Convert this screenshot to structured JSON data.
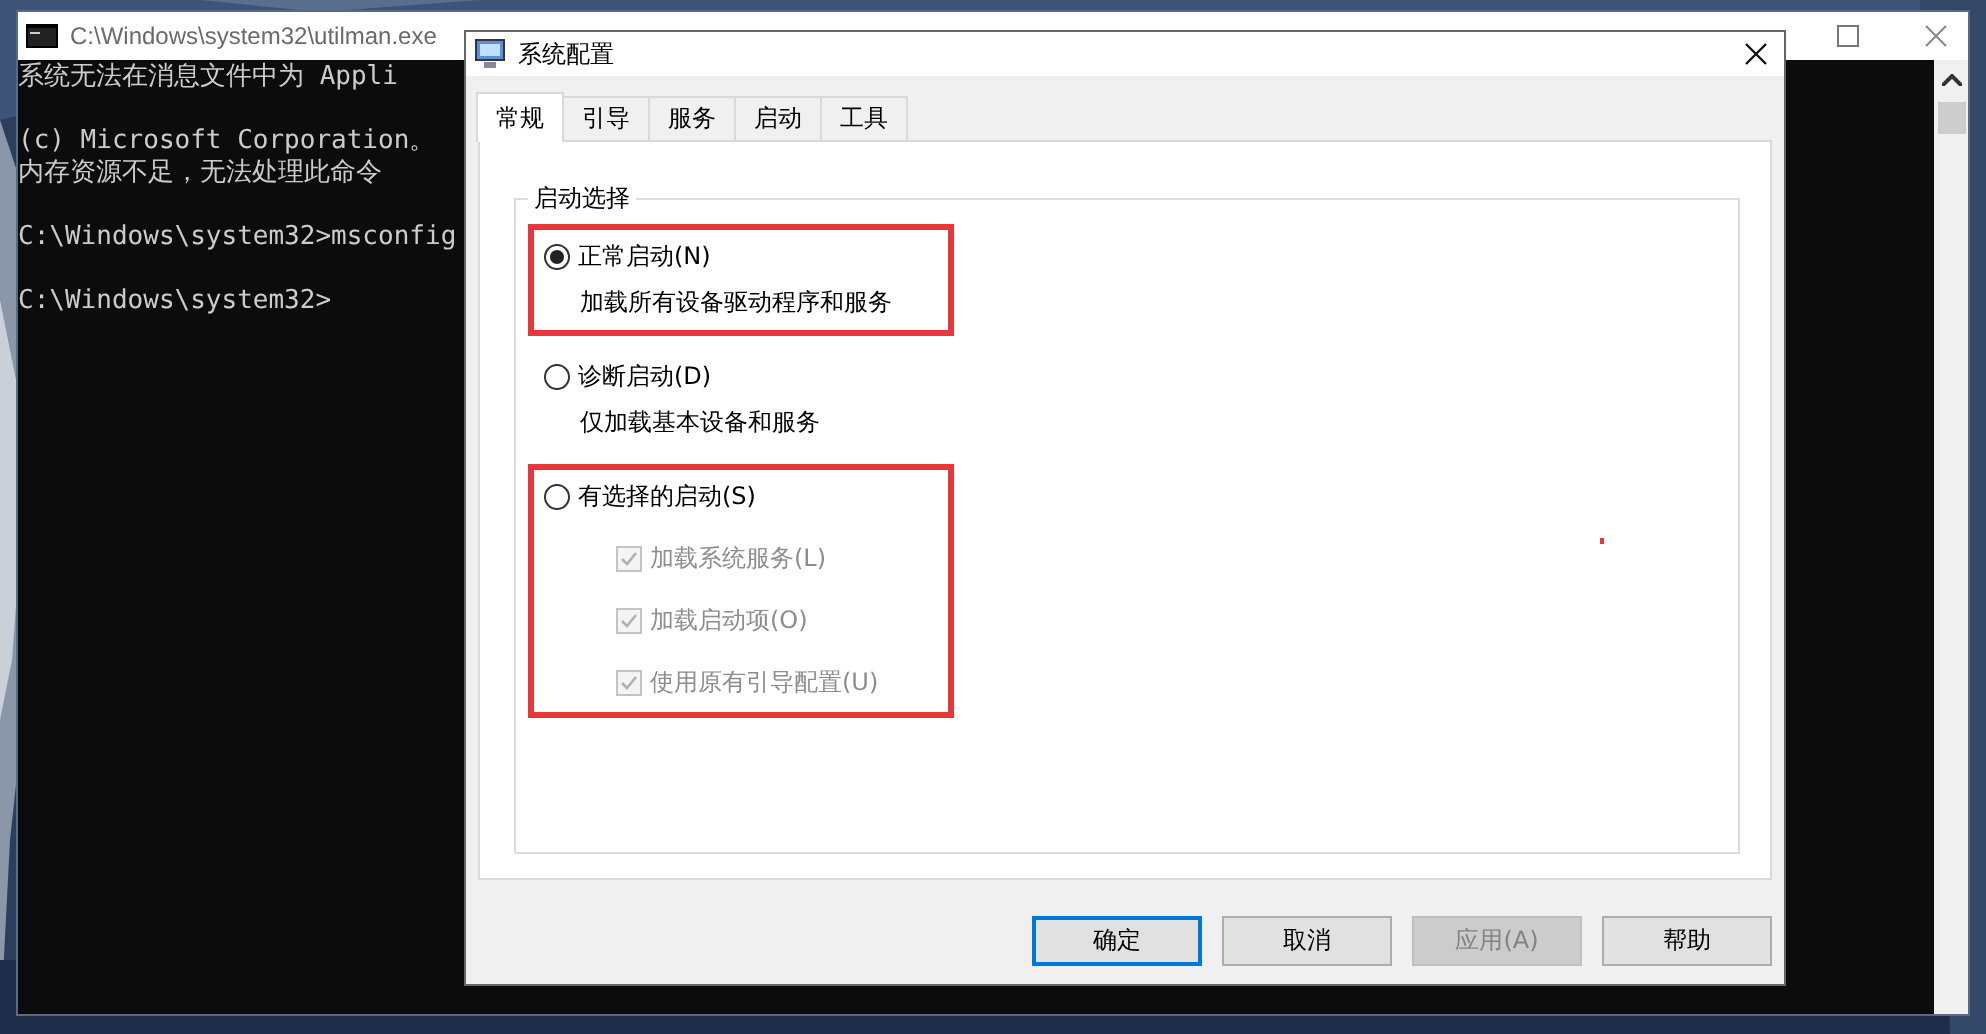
{
  "console": {
    "title": "C:\\Windows\\system32\\utilman.exe",
    "blocks": [
      [
        "系统无法在消息文件中为 Appli"
      ],
      [
        "(c) Microsoft Corporation。",
        "内存资源不足，无法处理此命令"
      ],
      [
        "C:\\Windows\\system32>msconfig"
      ],
      [
        "C:\\Windows\\system32>"
      ]
    ]
  },
  "dialog": {
    "title": "系统配置",
    "tabs": [
      {
        "label": "常规",
        "selected": true
      },
      {
        "label": "引导",
        "selected": false
      },
      {
        "label": "服务",
        "selected": false
      },
      {
        "label": "启动",
        "selected": false
      },
      {
        "label": "工具",
        "selected": false
      }
    ],
    "group": {
      "title": "启动选择",
      "options": [
        {
          "label": "正常启动(N)",
          "selected": true,
          "highlighted": true,
          "description": "加载所有设备驱动程序和服务"
        },
        {
          "label": "诊断启动(D)",
          "selected": false,
          "highlighted": false,
          "description": "仅加载基本设备和服务"
        },
        {
          "label": "有选择的启动(S)",
          "selected": false,
          "highlighted": true,
          "children": [
            {
              "label": "加载系统服务(L)",
              "checked": true,
              "disabled": true
            },
            {
              "label": "加载启动项(O)",
              "checked": true,
              "disabled": true
            },
            {
              "label": "使用原有引导配置(U)",
              "checked": true,
              "disabled": true
            }
          ]
        }
      ]
    },
    "buttons": [
      {
        "label": "确定",
        "kind": "default",
        "disabled": false
      },
      {
        "label": "取消",
        "kind": "normal",
        "disabled": false
      },
      {
        "label": "应用(A)",
        "kind": "normal",
        "disabled": true
      },
      {
        "label": "帮助",
        "kind": "normal",
        "disabled": false
      }
    ]
  }
}
